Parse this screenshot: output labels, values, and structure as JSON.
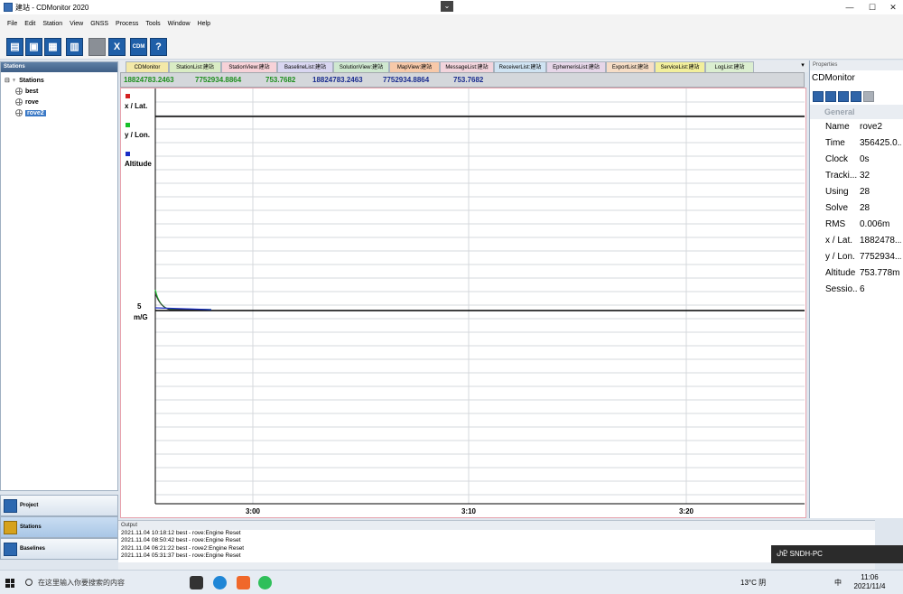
{
  "window": {
    "title": "建站 - CDMonitor 2020",
    "minimize": "—",
    "maximize": "☐",
    "close": "✕"
  },
  "menu": [
    "File",
    "Edit",
    "Station",
    "View",
    "GNSS",
    "Process",
    "Tools",
    "Window",
    "Help"
  ],
  "toolbar": {
    "cdm_label": "CDM",
    "help_label": "?",
    "close_label": "X"
  },
  "left_panel": {
    "title": "Stations",
    "root": "Stations",
    "items": [
      "best",
      "rove",
      "rove2"
    ],
    "selected": "rove2"
  },
  "left_buttons": [
    "Project",
    "Stations",
    "Baselines"
  ],
  "tabs": [
    {
      "label": "CDMonitor",
      "color": "#f3e9a8"
    },
    {
      "label": "StationList:建站",
      "color": "#d9ecc4"
    },
    {
      "label": "StationView:建站",
      "color": "#f7d2d8"
    },
    {
      "label": "BaselineList:建站",
      "color": "#d9d6f1"
    },
    {
      "label": "SolutionView:建站",
      "color": "#cfe8d0"
    },
    {
      "label": "MapView:建站",
      "color": "#f7c9a9"
    },
    {
      "label": "MessageList:建站",
      "color": "#f2d4dc"
    },
    {
      "label": "ReceiverList:建站",
      "color": "#cfe3f2"
    },
    {
      "label": "EphemerisList:建站",
      "color": "#e6d6e8"
    },
    {
      "label": "ExportList:建站",
      "color": "#f6ddc6"
    },
    {
      "label": "ServiceList:建站",
      "color": "#f2ef9c"
    },
    {
      "label": "LogList:建站",
      "color": "#dbeed0"
    }
  ],
  "coords": {
    "green": [
      "18824783.2463",
      "7752934.8864",
      "753.7682"
    ],
    "blue": [
      "18824783.2463",
      "7752934.8864",
      "753.7682"
    ]
  },
  "chart": {
    "legend": [
      {
        "label": "x / Lat.",
        "color": "#d42020"
      },
      {
        "label": "y / Lon.",
        "color": "#19c02a"
      },
      {
        "label": "Altitude",
        "color": "#1a2dc6"
      }
    ],
    "scale_label": "5",
    "unit_label": "m/G",
    "x_ticks": [
      "3:00",
      "3:10",
      "3:20"
    ]
  },
  "chart_data": {
    "type": "line",
    "x_ticks": [
      "3:00",
      "3:10",
      "3:20"
    ],
    "series": [
      {
        "name": "x / Lat.",
        "color": "#d42020"
      },
      {
        "name": "y / Lon.",
        "color": "#19c02a"
      },
      {
        "name": "Altitude",
        "color": "#1a2dc6"
      }
    ],
    "ylabel": "m/G",
    "y_tick": "5",
    "grid": true
  },
  "properties": {
    "header": "Properties",
    "object": "CDMonitor",
    "group": "General",
    "rows": [
      {
        "k": "Name",
        "v": "rove2"
      },
      {
        "k": "Time",
        "v": "356425.0..."
      },
      {
        "k": "Clock",
        "v": "0s"
      },
      {
        "k": "Tracki...",
        "v": "32"
      },
      {
        "k": "Using",
        "v": "28"
      },
      {
        "k": "Solve",
        "v": "28"
      },
      {
        "k": "RMS",
        "v": "0.006m"
      },
      {
        "k": "x / Lat.",
        "v": "1882478..."
      },
      {
        "k": "y / Lon.",
        "v": "7752934..."
      },
      {
        "k": "Altitude",
        "v": "753.778m"
      },
      {
        "k": "Sessio...",
        "v": "6"
      }
    ]
  },
  "output": {
    "title": "Output",
    "lines": [
      "2021.11.04 10:18:12 best - rove:Engine Reset",
      "2021.11.04 08:50:42 best - rove:Engine Reset",
      "2021.11.04 06:21:22 best - rove2:Engine Reset",
      "2021.11.04 05:31:37 best - rove:Engine Reset"
    ]
  },
  "notification": "SNDH-PC",
  "taskbar": {
    "search_placeholder": "在这里输入你要搜索的内容",
    "weather": "13°C 阴",
    "ime": "中",
    "time": "11:06",
    "date": "2021/11/4"
  }
}
